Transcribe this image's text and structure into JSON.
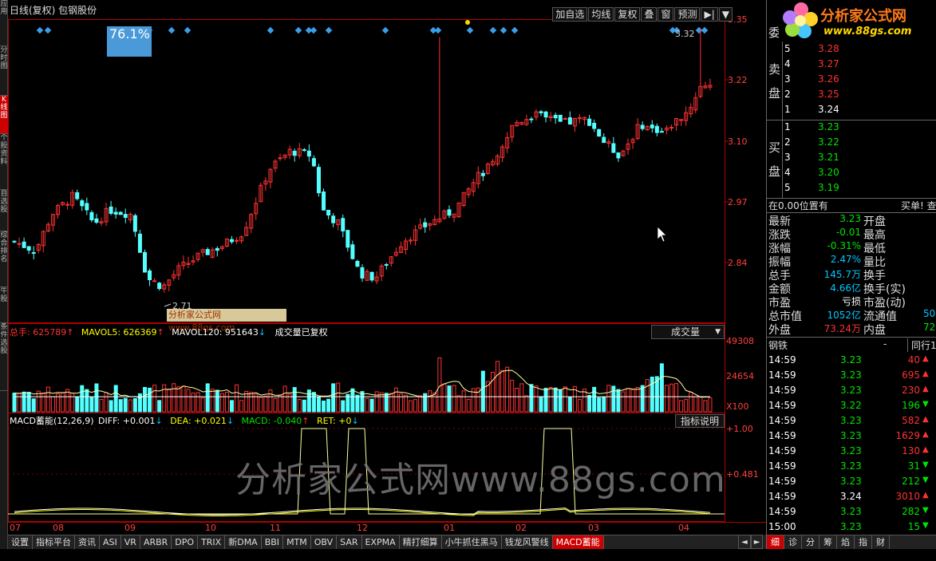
{
  "header": {
    "title": "日线(复权)  包钢股份",
    "toolbar": [
      "加自选",
      "均线",
      "复权",
      "叠",
      "窗",
      "预测",
      "▶|",
      "▼"
    ]
  },
  "left_tabs": [
    "应用",
    "分时图",
    "K线图",
    "个股资料",
    "自选股",
    "综合排名",
    "牛股",
    "条件选股"
  ],
  "price_axis": [
    "3.35",
    "3.22",
    "3.10",
    "2.97",
    "2.84"
  ],
  "badge": {
    "percent": "76.1%"
  },
  "high_label": "3.32",
  "low_label": "2.71",
  "site_banner": "分析家公式网www.88gs.com",
  "volume_header": {
    "total": "总手: 625789",
    "ma5": "MAVOL5: 626369",
    "ma120": "MAVOL120: 951643",
    "note": "成交量已复权",
    "selector": "成交量"
  },
  "volume_axis": [
    "49308",
    "24654",
    "X100"
  ],
  "macd_header": {
    "name": "MACD蓄能(12,26,9)",
    "diff": "DIFF: +0.001",
    "dea": "DEA: +0.021",
    "macd": "MACD: -0.040",
    "ret": "RET: +0",
    "help": "指标说明"
  },
  "macd_axis": [
    "+1.00",
    "+0.481"
  ],
  "x_axis": [
    "07",
    "08",
    "09",
    "10",
    "11",
    "12",
    "01",
    "02",
    "03",
    "04"
  ],
  "watermark": "分析家公式网www.88gs.com",
  "bottom_tabs": [
    "设置",
    "指标平台",
    "资讯",
    "ASI",
    "VR",
    "ARBR",
    "DPO",
    "TRIX",
    "新DMA",
    "BBI",
    "MTM",
    "OBV",
    "SAR",
    "EXPMA",
    "精打细算",
    "小牛抓住黑马",
    "钱龙风警线",
    "MACD蓄能"
  ],
  "nav_arrows": [
    "◄",
    "►"
  ],
  "logo": {
    "text": "分析家公式网",
    "url": "www.88gs.com"
  },
  "order_book": {
    "sell_label": "卖盘",
    "buy_label": "买盘",
    "top_label": "委",
    "sell": [
      {
        "n": "5",
        "p": "3.28"
      },
      {
        "n": "4",
        "p": "3.27"
      },
      {
        "n": "3",
        "p": "3.26"
      },
      {
        "n": "2",
        "p": "3.25"
      },
      {
        "n": "1",
        "p": "3.24"
      }
    ],
    "buy": [
      {
        "n": "1",
        "p": "3.23"
      },
      {
        "n": "2",
        "p": "3.22"
      },
      {
        "n": "3",
        "p": "3.21"
      },
      {
        "n": "4",
        "p": "3.20"
      },
      {
        "n": "5",
        "p": "3.19"
      }
    ]
  },
  "position_line": {
    "left": "在0.00位置有",
    "right": "买单! 查"
  },
  "quote": [
    {
      "k": "最新",
      "v": "3.23",
      "k2": "开盘"
    },
    {
      "k": "涨跌",
      "v": "-0.01",
      "k2": "最高"
    },
    {
      "k": "涨幅",
      "v": "-0.31%",
      "k2": "最低"
    },
    {
      "k": "振幅",
      "v": "2.47%",
      "k2": "量比"
    },
    {
      "k": "总手",
      "v": "145.7万",
      "k2": "换手"
    },
    {
      "k": "金额",
      "v": "4.66亿",
      "k2": "换手(实)"
    },
    {
      "k": "市盈",
      "v": "亏损",
      "k2": "市盈(动)"
    },
    {
      "k": "总市值",
      "v": "1052亿",
      "k2": "流通值",
      "v2": "50"
    },
    {
      "k": "外盘",
      "v": "73.24万",
      "k2": "内盘",
      "v2": "72"
    }
  ],
  "sector": {
    "name": "钢铁",
    "dash": "-",
    "right": "同行1"
  },
  "ticks": [
    {
      "t": "14:59",
      "p": "3.23",
      "v": "40",
      "d": "up"
    },
    {
      "t": "14:59",
      "p": "3.23",
      "v": "695",
      "d": "up"
    },
    {
      "t": "14:59",
      "p": "3.23",
      "v": "230",
      "d": "up"
    },
    {
      "t": "14:59",
      "p": "3.22",
      "v": "196",
      "d": "down"
    },
    {
      "t": "14:59",
      "p": "3.23",
      "v": "582",
      "d": "up"
    },
    {
      "t": "14:59",
      "p": "3.23",
      "v": "1629",
      "d": "up"
    },
    {
      "t": "14:59",
      "p": "3.23",
      "v": "130",
      "d": "up"
    },
    {
      "t": "14:59",
      "p": "3.23",
      "v": "31",
      "d": "down"
    },
    {
      "t": "14:59",
      "p": "3.23",
      "v": "212",
      "d": "down"
    },
    {
      "t": "14:59",
      "p": "3.24",
      "v": "3010",
      "d": "up"
    },
    {
      "t": "14:59",
      "p": "3.23",
      "v": "282",
      "d": "down"
    },
    {
      "t": "15:00",
      "p": "3.23",
      "v": "15",
      "d": "down"
    }
  ],
  "right_bottom_tabs": [
    "细",
    "诊",
    "分",
    "筹",
    "焰",
    "指",
    "财"
  ],
  "colors": {
    "up": "#ff3232",
    "down": "#54ffff",
    "axis": "#b00000",
    "grid": "#800000",
    "diamond": "#3a9ee8"
  }
}
